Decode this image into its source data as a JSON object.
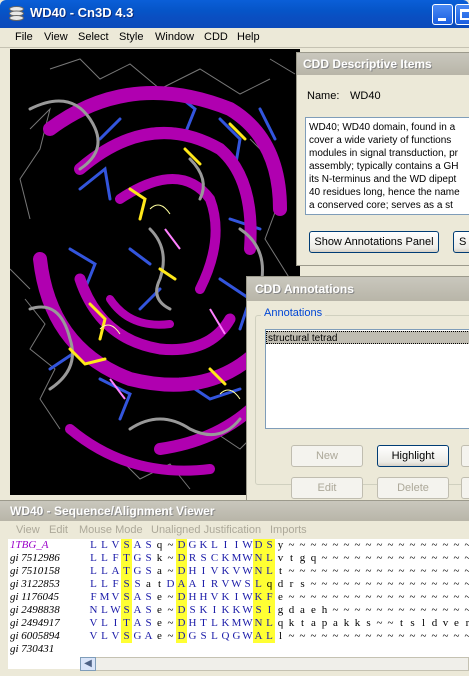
{
  "window": {
    "title": "WD40 - Cn3D 4.3"
  },
  "menu": [
    "File",
    "View",
    "Select",
    "Style",
    "Window",
    "CDD",
    "Help"
  ],
  "colors": {
    "helix_magenta": "#b000b0",
    "backbone_gray": "#888888",
    "sidechain_blue": "#3355dd",
    "highlight_yellow": "#ffff33"
  },
  "cdd_descriptive": {
    "title": "CDD Descriptive Items",
    "name_label": "Name:",
    "name_value": "WD40",
    "description_lines": [
      "WD40; WD40 domain, found in a",
      "cover a wide variety of functions",
      "modules in signal transduction, pr",
      "assembly; typically contains a GH",
      "its N-terminus and the WD dipept",
      "40 residues long, hence the name",
      "a conserved core; serves as a st"
    ],
    "show_annotations_button": "Show Annotations Panel",
    "second_button": "S"
  },
  "cdd_annotations": {
    "title": "CDD Annotations",
    "group_label": "Annotations",
    "items": [
      "structural tetrad"
    ],
    "buttons": {
      "new": "New",
      "highlight": "Highlight",
      "edit": "Edit",
      "delete": "Delete"
    }
  },
  "sequence_viewer": {
    "title": "WD40 - Sequence/Alignment Viewer",
    "menu": [
      "View",
      "Edit",
      "Mouse Mode",
      "Unaligned Justification",
      "Imports"
    ],
    "rows": [
      {
        "id": "1TBG_A",
        "residues": "LLVSASq~DGKLIIWDSy~~~~~~~~~~~~~~~~~~~",
        "master": true
      },
      {
        "id": "gi 7512986",
        "residues": "LLFTGSk~DRSCKMWNLvtgq~~~~~~~~~~~~~~~~"
      },
      {
        "id": "gi 7510158",
        "residues": "LLATGSa~DHIVKVWNLt~~~~~~~~~~~~~~~~~~~"
      },
      {
        "id": "gi 3122853",
        "residues": "LLFSSatDAAIRVWSLqdrs~~~~~~~~~~~~~~~~~"
      },
      {
        "id": "gi 1176045",
        "residues": "FMVSASe~DHHVKIWKFe~~~~~~~~~~~~~~~~~~~"
      },
      {
        "id": "gi 2498838",
        "residues": "NLWSASe~DSKIKKWSIgdaeh~~~~~~~~~~~~~~sl"
      },
      {
        "id": "gi 2494917",
        "residues": "VLITASe~DHTLKMWNLqktapakks~~tsldver"
      },
      {
        "id": "gi 6005894",
        "residues": "VLVSGAe~DGSLQGWALl~~~~~~~~~~~~~~~~~~~"
      },
      {
        "id": "gi 730431",
        "residues": ""
      }
    ],
    "highlight_columns": [
      3,
      8,
      16
    ],
    "hl_column_span": [
      [
        3,
        3
      ],
      [
        8,
        8
      ],
      [
        15,
        16
      ]
    ]
  }
}
